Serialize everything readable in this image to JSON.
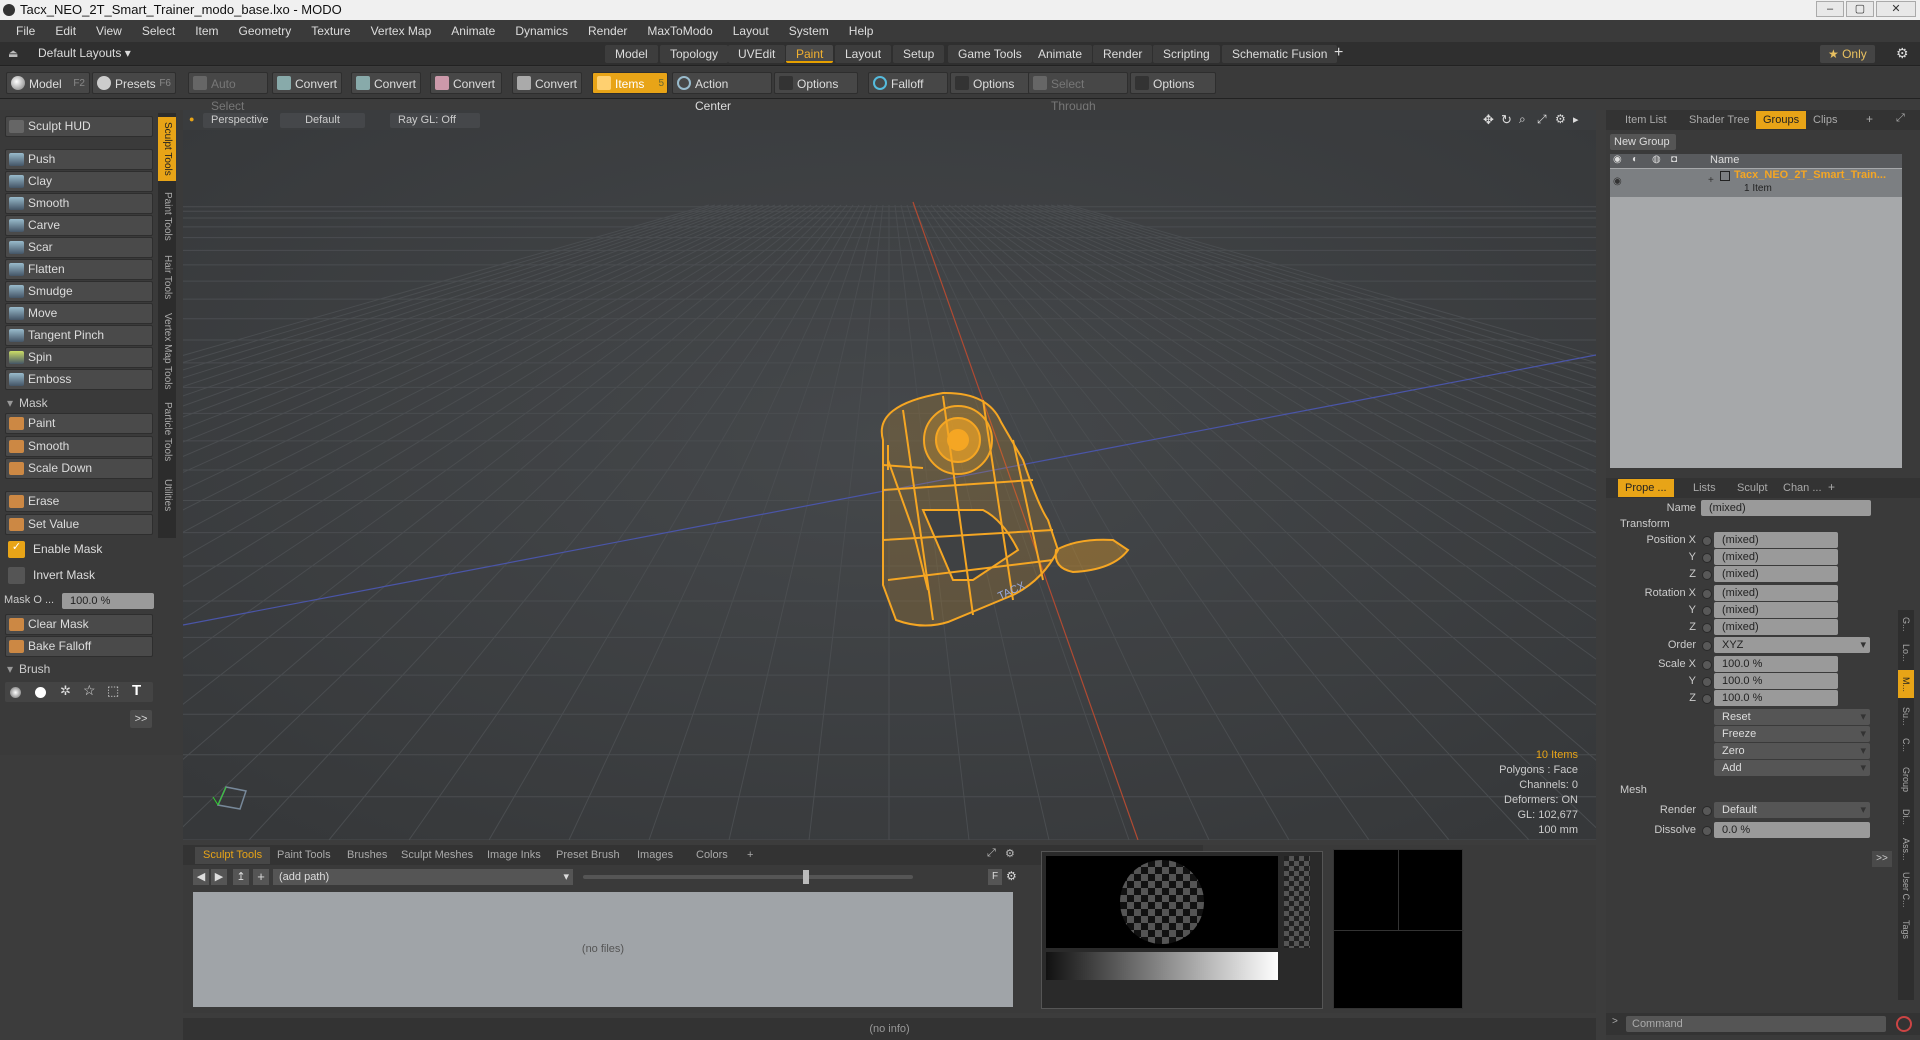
{
  "window": {
    "title": "Tacx_NEO_2T_Smart_Trainer_modo_base.lxo - MODO"
  },
  "menu": [
    "File",
    "Edit",
    "View",
    "Select",
    "Item",
    "Geometry",
    "Texture",
    "Vertex Map",
    "Animate",
    "Dynamics",
    "Render",
    "MaxToModo",
    "Layout",
    "System",
    "Help"
  ],
  "layouts": {
    "selector": "Default Layouts ▾",
    "tabs": [
      "Model",
      "Topology",
      "UVEdit",
      "Paint",
      "Layout",
      "Setup",
      "Game Tools",
      "Animate",
      "Render",
      "Scripting",
      "Schematic Fusion"
    ],
    "active": "Paint",
    "add": "+",
    "only": "★ Only",
    "gear": "⚙"
  },
  "toolbar": {
    "model": "Model",
    "model_key": "F2",
    "presets": "Presets",
    "presets_key": "F6",
    "auto_select": "Auto Select",
    "convert": "Convert",
    "items": "Items",
    "items_key": "5",
    "action_center": "Action Center",
    "options": "Options",
    "falloff": "Falloff",
    "select_through": "Select Through"
  },
  "sculpt": {
    "hud": "Sculpt HUD",
    "tools": [
      "Push",
      "Clay",
      "Smooth",
      "Carve",
      "Scar",
      "Flatten",
      "Smudge",
      "Move",
      "Tangent Pinch",
      "Spin",
      "Emboss"
    ],
    "mask_section": "Mask",
    "mask_tools": [
      "Paint",
      "Smooth",
      "Scale Down"
    ],
    "erase": "Erase",
    "set_value": "Set Value",
    "enable_mask": "Enable Mask",
    "invert_mask": "Invert Mask",
    "mask_opacity_label": "Mask O ...",
    "mask_opacity_value": "100.0 %",
    "clear_mask": "Clear Mask",
    "bake_falloff": "Bake Falloff",
    "brush_section": "Brush",
    "more": ">>"
  },
  "side_tabs": [
    "Sculpt Tools",
    "Paint Tools",
    "Hair Tools",
    "Vertex Map Tools",
    "Particle Tools",
    "Utilities"
  ],
  "viewport": {
    "view": "Perspective",
    "shading": "Default",
    "raygl": "Ray GL: Off",
    "model_label": "TACX",
    "stats": {
      "items": "10 Items",
      "polygons": "Polygons : Face",
      "channels": "Channels: 0",
      "deformers": "Deformers: ON",
      "gl": "GL: 102,677",
      "unit": "100 mm"
    }
  },
  "bottom": {
    "tabs": [
      "Sculpt Tools",
      "Paint Tools",
      "Brushes",
      "Sculpt Meshes",
      "Image Inks",
      "Preset Brush",
      "Images",
      "Colors"
    ],
    "add": "+",
    "path": "(add path)",
    "no_files": "(no files)",
    "f_label": "F",
    "info": "(no info)"
  },
  "right_top": {
    "tabs": [
      "Item List",
      "Shader Tree",
      "Groups",
      "Clips"
    ],
    "active": "Groups",
    "new_group": "New Group",
    "col_name": "Name",
    "group_name": "Tacx_NEO_2T_Smart_Train...",
    "group_count": "1 Item"
  },
  "properties": {
    "tabs": [
      "Prope ...",
      "Lists",
      "Sculpt",
      "Chan ..."
    ],
    "active": "Prope ...",
    "name_label": "Name",
    "name_value": "(mixed)",
    "transform": "Transform",
    "position_x": "Position X",
    "rotation_x": "Rotation X",
    "scale_x": "Scale X",
    "y": "Y",
    "z": "Z",
    "mixed": "(mixed)",
    "order_label": "Order",
    "order": "XYZ",
    "scale": "100.0 %",
    "reset": "Reset",
    "freeze": "Freeze",
    "zero": "Zero",
    "add": "Add",
    "mesh": "Mesh",
    "render_label": "Render",
    "render_value": "Default",
    "dissolve_label": "Dissolve",
    "dissolve_value": "0.0 %",
    "more": ">>"
  },
  "right_vtabs": [
    "G...",
    "Lo...",
    "M...",
    "Su...",
    "C...",
    "Group",
    "Di...",
    "Ass...",
    "User C...",
    "Tags"
  ],
  "command": "Command"
}
